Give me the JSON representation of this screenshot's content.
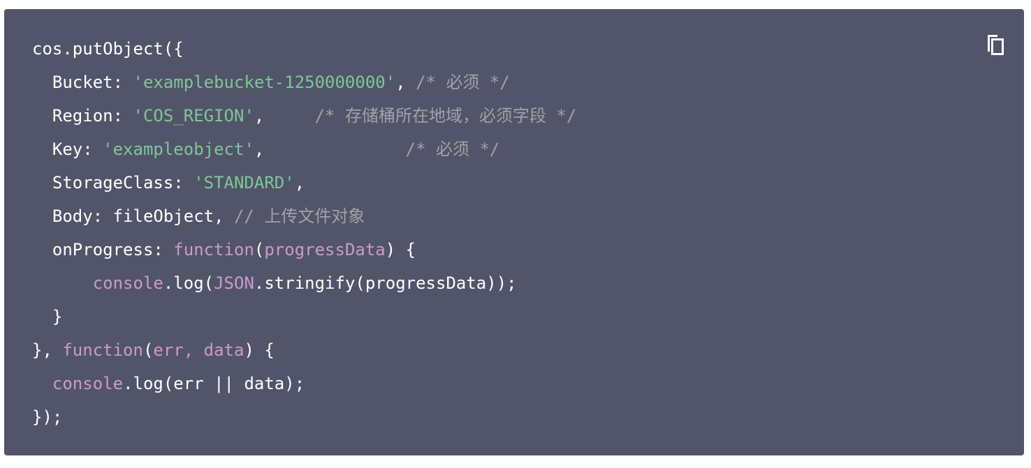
{
  "colors": {
    "background": "#525569",
    "plain": "#ffffff",
    "string": "#7ec699",
    "comment": "#a0a1a7",
    "keyword": "#cc99cd"
  },
  "copy_button": {
    "icon": "copy-icon"
  },
  "lines": [
    [
      {
        "t": "cos.putObject({",
        "c": "pln"
      }
    ],
    [
      {
        "t": "  Bucket: ",
        "c": "pln"
      },
      {
        "t": "'examplebucket-1250000000'",
        "c": "str"
      },
      {
        "t": ", ",
        "c": "pln"
      },
      {
        "t": "/* 必须 */",
        "c": "cmt"
      }
    ],
    [
      {
        "t": "  Region: ",
        "c": "pln"
      },
      {
        "t": "'COS_REGION'",
        "c": "str"
      },
      {
        "t": ",     ",
        "c": "pln"
      },
      {
        "t": "/* 存储桶所在地域，必须字段 */",
        "c": "cmt"
      }
    ],
    [
      {
        "t": "  Key: ",
        "c": "pln"
      },
      {
        "t": "'exampleobject'",
        "c": "str"
      },
      {
        "t": ",              ",
        "c": "pln"
      },
      {
        "t": "/* 必须 */",
        "c": "cmt"
      }
    ],
    [
      {
        "t": "  StorageClass: ",
        "c": "pln"
      },
      {
        "t": "'STANDARD'",
        "c": "str"
      },
      {
        "t": ",",
        "c": "pln"
      }
    ],
    [
      {
        "t": "  Body: fileObject, ",
        "c": "pln"
      },
      {
        "t": "// 上传文件对象",
        "c": "cmt"
      }
    ],
    [
      {
        "t": "  onProgress: ",
        "c": "pln"
      },
      {
        "t": "function",
        "c": "kw"
      },
      {
        "t": "(",
        "c": "pln"
      },
      {
        "t": "progressData",
        "c": "kw"
      },
      {
        "t": ") {",
        "c": "pln"
      }
    ],
    [
      {
        "t": "      ",
        "c": "pln"
      },
      {
        "t": "console",
        "c": "kw"
      },
      {
        "t": ".log(",
        "c": "pln"
      },
      {
        "t": "JSON",
        "c": "kw"
      },
      {
        "t": ".stringify(progressData));",
        "c": "pln"
      }
    ],
    [
      {
        "t": "  }",
        "c": "pln"
      }
    ],
    [
      {
        "t": "}, ",
        "c": "pln"
      },
      {
        "t": "function",
        "c": "kw"
      },
      {
        "t": "(",
        "c": "pln"
      },
      {
        "t": "err, data",
        "c": "kw"
      },
      {
        "t": ") {",
        "c": "pln"
      }
    ],
    [
      {
        "t": "  ",
        "c": "pln"
      },
      {
        "t": "console",
        "c": "kw"
      },
      {
        "t": ".log(err || data);",
        "c": "pln"
      }
    ],
    [
      {
        "t": "});",
        "c": "pln"
      }
    ]
  ]
}
